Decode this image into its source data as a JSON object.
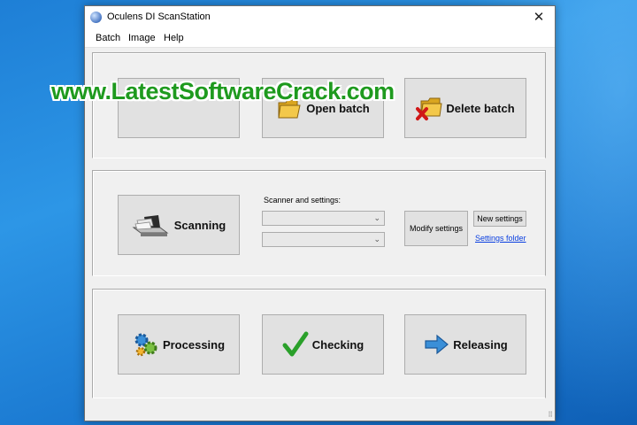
{
  "window": {
    "title": "Oculens DI ScanStation",
    "close_glyph": "✕"
  },
  "menu": {
    "items": [
      "Batch",
      "Image",
      "Help"
    ]
  },
  "top_section": {
    "open_batch": {
      "label": "Open batch",
      "icon": "folder-icon"
    },
    "delete_batch": {
      "label": "Delete batch",
      "icon": "folder-delete-icon"
    }
  },
  "scan_section": {
    "scanning": {
      "label": "Scanning",
      "icon": "scanner-icon"
    },
    "scanner_settings_label": "Scanner and settings:",
    "combo_arrow": "⌄",
    "modify_settings": "Modify settings",
    "new_settings": "New settings",
    "settings_folder": "Settings folder"
  },
  "bottom_section": {
    "processing": {
      "label": "Processing",
      "icon": "gears-icon"
    },
    "checking": {
      "label": "Checking",
      "icon": "checkmark-icon"
    },
    "releasing": {
      "label": "Releasing",
      "icon": "arrow-right-icon"
    }
  },
  "watermark": "www.LatestSoftwareCrack.com",
  "resize_grip": "⠿"
}
